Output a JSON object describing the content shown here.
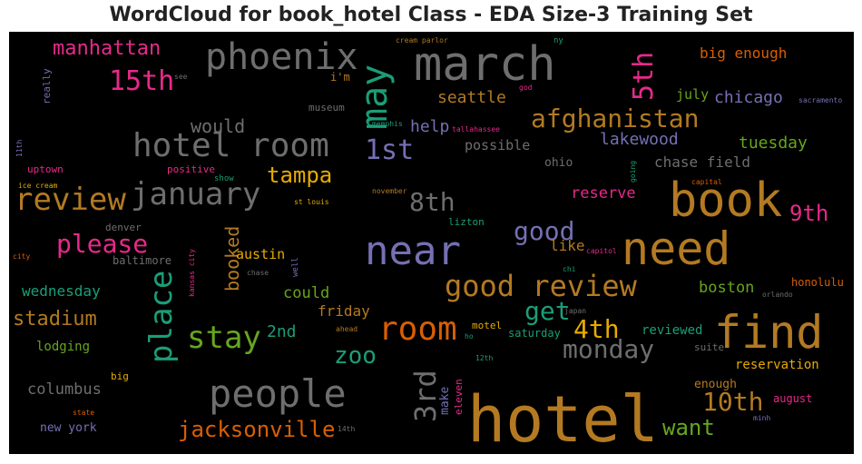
{
  "title": "WordCloud for book_hotel Class - EDA Size-3 Training Set",
  "colors": {
    "gold": "#b37a22",
    "gray": "#6e6e6e",
    "slate": "#7570b3",
    "pink": "#e7298a",
    "green": "#66a61e",
    "teal": "#1b9e77",
    "orange": "#d95f02",
    "yellow": "#e6ab02"
  },
  "words": [
    {
      "text": "hotel",
      "color": "gold"
    },
    {
      "text": "march",
      "color": "gray"
    },
    {
      "text": "book",
      "color": "gold"
    },
    {
      "text": "need",
      "color": "gold"
    },
    {
      "text": "find",
      "color": "gold"
    },
    {
      "text": "near",
      "color": "slate"
    },
    {
      "text": "people",
      "color": "gray"
    },
    {
      "text": "hotel room",
      "color": "gray"
    },
    {
      "text": "phoenix",
      "color": "gray"
    },
    {
      "text": "may",
      "color": "teal"
    },
    {
      "text": "review",
      "color": "gold"
    },
    {
      "text": "january",
      "color": "gray"
    },
    {
      "text": "good review",
      "color": "gold"
    },
    {
      "text": "afghanistan",
      "color": "gold"
    },
    {
      "text": "room",
      "color": "orange"
    },
    {
      "text": "stay",
      "color": "green"
    },
    {
      "text": "place",
      "color": "teal"
    },
    {
      "text": "3rd",
      "color": "gray"
    },
    {
      "text": "please",
      "color": "pink"
    },
    {
      "text": "15th",
      "color": "pink"
    },
    {
      "text": "5th",
      "color": "pink"
    },
    {
      "text": "1st",
      "color": "slate"
    },
    {
      "text": "monday",
      "color": "gray"
    },
    {
      "text": "jacksonville",
      "color": "orange"
    },
    {
      "text": "10th",
      "color": "gold"
    },
    {
      "text": "good",
      "color": "slate"
    },
    {
      "text": "get",
      "color": "teal"
    },
    {
      "text": "4th",
      "color": "yellow"
    },
    {
      "text": "zoo",
      "color": "teal"
    },
    {
      "text": "tampa",
      "color": "yellow"
    },
    {
      "text": "8th",
      "color": "gray"
    },
    {
      "text": "9th",
      "color": "pink"
    },
    {
      "text": "manhattan",
      "color": "pink"
    },
    {
      "text": "stadium",
      "color": "gold"
    },
    {
      "text": "want",
      "color": "green"
    },
    {
      "text": "would",
      "color": "gray"
    },
    {
      "text": "booked",
      "color": "gold"
    },
    {
      "text": "seattle",
      "color": "gold"
    },
    {
      "text": "chicago",
      "color": "slate"
    },
    {
      "text": "lakewood",
      "color": "slate"
    },
    {
      "text": "tuesday",
      "color": "green"
    },
    {
      "text": "help",
      "color": "slate"
    },
    {
      "text": "chase field",
      "color": "gray"
    },
    {
      "text": "reserve",
      "color": "pink"
    },
    {
      "text": "big enough",
      "color": "orange"
    },
    {
      "text": "columbus",
      "color": "gray"
    },
    {
      "text": "wednesday",
      "color": "teal"
    },
    {
      "text": "boston",
      "color": "green"
    },
    {
      "text": "could",
      "color": "green"
    },
    {
      "text": "friday",
      "color": "gold"
    },
    {
      "text": "2nd",
      "color": "teal"
    },
    {
      "text": "austin",
      "color": "yellow"
    },
    {
      "text": "like",
      "color": "gold"
    },
    {
      "text": "possible",
      "color": "gray"
    },
    {
      "text": "july",
      "color": "green"
    },
    {
      "text": "reservation",
      "color": "yellow"
    },
    {
      "text": "lodging",
      "color": "green"
    },
    {
      "text": "reviewed",
      "color": "teal"
    },
    {
      "text": "new york",
      "color": "slate"
    },
    {
      "text": "make",
      "color": "slate"
    },
    {
      "text": "eleven",
      "color": "pink"
    },
    {
      "text": "ohio",
      "color": "gray"
    },
    {
      "text": "baltimore",
      "color": "gray"
    },
    {
      "text": "i'm",
      "color": "gold"
    },
    {
      "text": "museum",
      "color": "gray"
    },
    {
      "text": "honolulu",
      "color": "orange"
    },
    {
      "text": "enough",
      "color": "gold"
    },
    {
      "text": "august",
      "color": "pink"
    },
    {
      "text": "saturday",
      "color": "teal"
    },
    {
      "text": "uptown",
      "color": "pink"
    },
    {
      "text": "positive",
      "color": "pink"
    },
    {
      "text": "denver",
      "color": "gray"
    },
    {
      "text": "lizton",
      "color": "teal"
    },
    {
      "text": "motel",
      "color": "yellow"
    },
    {
      "text": "suite",
      "color": "gray"
    },
    {
      "text": "really",
      "color": "slate"
    },
    {
      "text": "cream parlor",
      "color": "gold"
    },
    {
      "text": "ny",
      "color": "teal"
    },
    {
      "text": "see",
      "color": "gray"
    },
    {
      "text": "god",
      "color": "pink"
    },
    {
      "text": "sacramento",
      "color": "slate"
    },
    {
      "text": "memphis",
      "color": "teal"
    },
    {
      "text": "tallahassee",
      "color": "pink"
    },
    {
      "text": "11th",
      "color": "slate"
    },
    {
      "text": "ice cream",
      "color": "yellow"
    },
    {
      "text": "show",
      "color": "teal"
    },
    {
      "text": "going",
      "color": "teal"
    },
    {
      "text": "november",
      "color": "gold"
    },
    {
      "text": "st louis",
      "color": "yellow"
    },
    {
      "text": "capital",
      "color": "orange"
    },
    {
      "text": "city",
      "color": "orange"
    },
    {
      "text": "kansas city",
      "color": "pink"
    },
    {
      "text": "chase",
      "color": "gray"
    },
    {
      "text": "well",
      "color": "slate"
    },
    {
      "text": "capitol",
      "color": "pink"
    },
    {
      "text": "chi",
      "color": "teal"
    },
    {
      "text": "orlando",
      "color": "gray"
    },
    {
      "text": "japan",
      "color": "gray"
    },
    {
      "text": "ahead",
      "color": "gold"
    },
    {
      "text": "ho",
      "color": "teal"
    },
    {
      "text": "12th",
      "color": "teal"
    },
    {
      "text": "big",
      "color": "yellow"
    },
    {
      "text": "state",
      "color": "orange"
    },
    {
      "text": "14th",
      "color": "gray"
    },
    {
      "text": "minh",
      "color": "slate"
    }
  ]
}
